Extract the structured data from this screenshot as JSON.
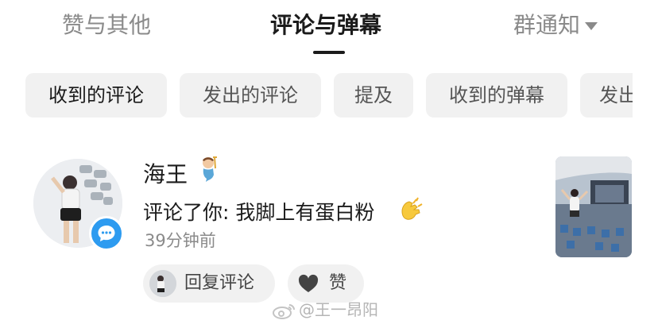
{
  "tabs": {
    "likes": "赞与其他",
    "comments": "评论与弹幕",
    "group": "群通知"
  },
  "filters": {
    "received_comments": "收到的评论",
    "sent_comments": "发出的评论",
    "mentions": "提及",
    "received_danmaku": "收到的弹幕",
    "sent_partial": "发出"
  },
  "comment": {
    "username": "海王",
    "username_emoji": "merperson-emoji",
    "text": "评论了你: 我脚上有蛋白粉",
    "text_emoji": "clapping-hands-emoji",
    "time": "39分钟前",
    "reply_label": "回复评论",
    "like_label": "赞"
  },
  "watermark": "@王一昂阳",
  "colors": {
    "chip_bg": "#f1f1f1",
    "badge_blue": "#2d9bf0",
    "active_text": "#1b1b1b",
    "muted_text": "#8a8a8a"
  }
}
